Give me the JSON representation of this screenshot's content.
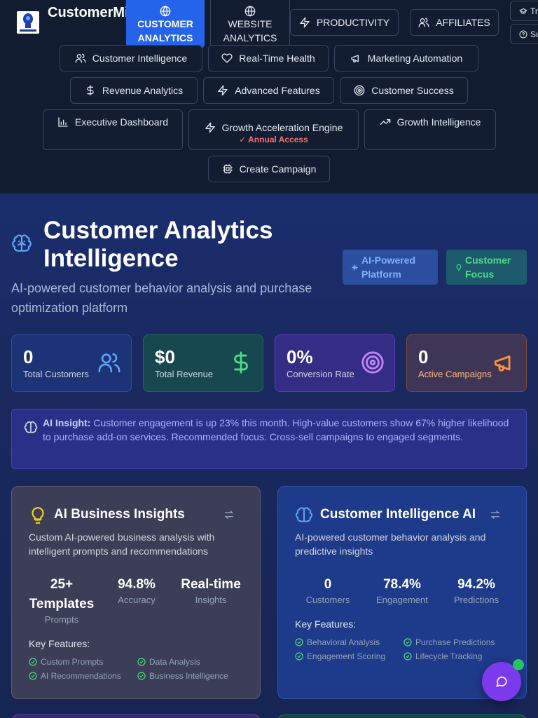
{
  "brand": {
    "name": "CustomerMind IQ"
  },
  "nav": {
    "top": [
      {
        "label": "CUSTOMER ANALYTICS",
        "icon": "brain-icon"
      },
      {
        "label": "WEBSITE ANALYTICS",
        "icon": "globe-icon"
      },
      {
        "label": "PRODUCTIVITY",
        "icon": "zap-icon"
      },
      {
        "label": "AFFILIATES",
        "icon": "users-icon"
      }
    ],
    "edge": [
      {
        "label": "Tr",
        "icon": "graduation-cap-icon"
      },
      {
        "label": "Su",
        "icon": "help-circle-icon"
      }
    ],
    "row1": [
      {
        "label": "Customer Intelligence",
        "icon": "users-icon"
      },
      {
        "label": "Real-Time Health",
        "icon": "heart-icon"
      },
      {
        "label": "Marketing Automation",
        "icon": "megaphone-icon"
      }
    ],
    "row2": [
      {
        "label": "Revenue Analytics",
        "icon": "dollar-sign-icon"
      },
      {
        "label": "Advanced Features",
        "icon": "zap-icon"
      },
      {
        "label": "Customer Success",
        "icon": "target-icon"
      }
    ],
    "row3": [
      {
        "label": "Executive Dashboard",
        "icon": "bar-chart-icon"
      },
      {
        "label": "Growth Acceleration Engine",
        "sub": "✓ Annual Access",
        "icon": "zap-icon"
      },
      {
        "label": "Growth Intelligence",
        "icon": "trending-up-icon"
      }
    ],
    "row4": [
      {
        "label": "Create Campaign",
        "icon": "cpu-icon"
      }
    ]
  },
  "hero": {
    "title_line1": "Customer Analytics",
    "title_line2": "Intelligence",
    "subtitle": "AI-powered customer behavior analysis and purchase optimization platform",
    "badge_ai": "AI-Powered Platform",
    "badge_focus": "Customer Focus"
  },
  "stats": [
    {
      "value": "0",
      "label": "Total Customers",
      "icon": "users-icon",
      "color": "#60a5fa"
    },
    {
      "value": "$0",
      "label": "Total Revenue",
      "icon": "dollar-sign-icon",
      "color": "#4ade80"
    },
    {
      "value": "0%",
      "label": "Conversion Rate",
      "icon": "target-icon",
      "color": "#c084fc"
    },
    {
      "value": "0",
      "label": "Active Campaigns",
      "icon": "megaphone-icon",
      "color": "#fb923c"
    }
  ],
  "insight": {
    "label": "AI Insight:",
    "text": "Customer engagement is up 23% this month. High-value customers show 67% higher likelihood to purchase add-on services. Recommended focus: Cross-sell campaigns to engaged segments."
  },
  "cards": [
    {
      "title": "AI Business Insights",
      "icon": "lightbulb-icon",
      "desc": "Custom AI-powered business analysis with intelligent prompts and recommendations",
      "metrics": [
        {
          "value": "25+ Templates",
          "label": "Prompts"
        },
        {
          "value": "94.8%",
          "label": "Accuracy"
        },
        {
          "value": "Real-time",
          "label": "Insights"
        }
      ],
      "features_title": "Key Features:",
      "features": [
        "Custom Prompts",
        "Data Analysis",
        "AI Recommendations",
        "Business Intelligence"
      ]
    },
    {
      "title": "Customer Intelligence AI",
      "icon": "brain-icon",
      "desc": "AI-powered customer behavior analysis and predictive insights",
      "metrics": [
        {
          "value": "0",
          "label": "Customers"
        },
        {
          "value": "78.4%",
          "label": "Engagement"
        },
        {
          "value": "94.2%",
          "label": "Predictions"
        }
      ],
      "features_title": "Key Features:",
      "features": [
        "Behavioral Analysis",
        "Purchase Predictions",
        "Engagement Scoring",
        "Lifecycle Tracking"
      ]
    }
  ],
  "chat": {
    "icon": "message-circle-icon",
    "status_color": "#22c55e"
  }
}
